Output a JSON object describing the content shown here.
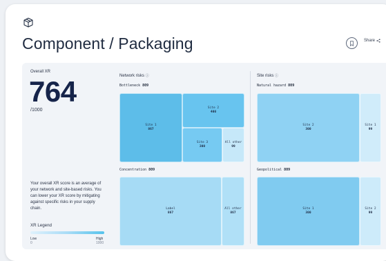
{
  "page": {
    "title": "Component / Packaging"
  },
  "header": {
    "share_label": "Share"
  },
  "overall": {
    "label": "Overall XR",
    "score": "764",
    "denominator": "/1000"
  },
  "description": "Your overall XR score is an average of your network and site-based risks. You can lower your XR score by mitigating against specific risks in your supply chain.",
  "legend": {
    "title": "XR Legend",
    "low": "Low",
    "low_value": "0",
    "high": "High",
    "high_value": "1000"
  },
  "network": {
    "title": "Network risks",
    "groups": [
      {
        "label": "Bottleneck",
        "score": "809",
        "tiles": [
          {
            "name": "Site 1",
            "value": "867",
            "color": "#5dbde9"
          },
          {
            "name": "Site 2",
            "value": "400",
            "color": "#68c4ef"
          },
          {
            "name": "Site 3",
            "value": "300",
            "color": "#76caf2"
          },
          {
            "name": "All other",
            "value": "99",
            "color": "#c6e8f9"
          }
        ]
      },
      {
        "label": "Concentration",
        "score": "809",
        "tiles": [
          {
            "name": "Label",
            "value": "867",
            "color": "#a6dbf5"
          },
          {
            "name": "All other",
            "value": "867",
            "color": "#b0e0f7"
          }
        ]
      }
    ]
  },
  "site": {
    "title": "Site risks",
    "groups": [
      {
        "label": "Natural hazard",
        "score": "809",
        "tiles": [
          {
            "name": "Site 2",
            "value": "300",
            "color": "#8fd2f3"
          },
          {
            "name": "Site 1",
            "value": "99",
            "color": "#d0ecfa"
          }
        ]
      },
      {
        "label": "Geopolitical",
        "score": "809",
        "tiles": [
          {
            "name": "Site 1",
            "value": "300",
            "color": "#80cbf0"
          },
          {
            "name": "Site 2",
            "value": "99",
            "color": "#cdebfa"
          }
        ]
      }
    ]
  }
}
